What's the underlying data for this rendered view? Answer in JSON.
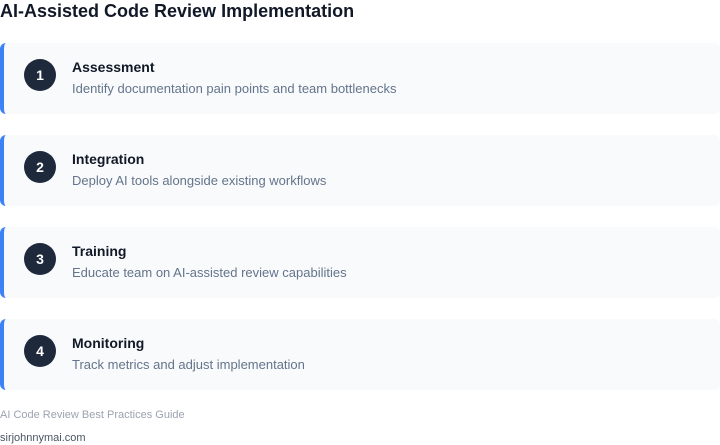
{
  "title": "AI-Assisted Code Review Implementation",
  "steps": [
    {
      "number": "1",
      "title": "Assessment",
      "description": "Identify documentation pain points and team bottlenecks"
    },
    {
      "number": "2",
      "title": "Integration",
      "description": "Deploy AI tools alongside existing workflows"
    },
    {
      "number": "3",
      "title": "Training",
      "description": "Educate team on AI-assisted review capabilities"
    },
    {
      "number": "4",
      "title": "Monitoring",
      "description": "Track metrics and adjust implementation"
    }
  ],
  "footer": {
    "caption": "AI Code Review Best Practices Guide",
    "credit": "sirjohnnymai.com"
  },
  "colors": {
    "accent": "#3b82f6",
    "badge": "#1e293b",
    "card_background": "#f8fafc"
  }
}
